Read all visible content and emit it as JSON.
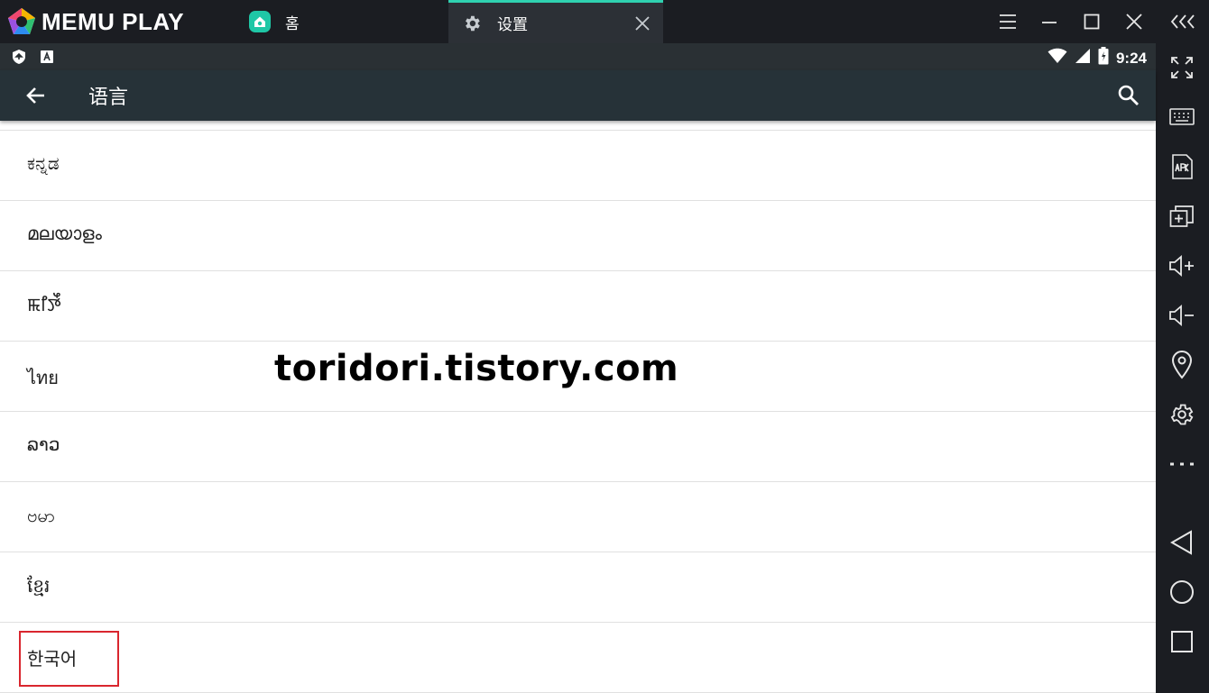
{
  "titlebar": {
    "brand": "MEMU PLAY",
    "tabs": [
      {
        "label": "홈",
        "icon": "home-app-icon",
        "active": false
      },
      {
        "label": "设置",
        "icon": "gear-icon",
        "active": true
      }
    ],
    "accent_color": "#2fd1b0"
  },
  "statusbar": {
    "time": "9:24"
  },
  "appbar": {
    "title": "语言"
  },
  "languages": [
    "ಕನ್ನಡ",
    "മലയാളം",
    "ꯃꯤꯇꯩ",
    "ไทย",
    "ລາວ",
    "ဗမာ",
    "ខ្មែរ",
    "한국어"
  ],
  "highlighted_item": "한국어",
  "highlight_color": "#d9262e",
  "watermark": "toridori.tistory.com"
}
